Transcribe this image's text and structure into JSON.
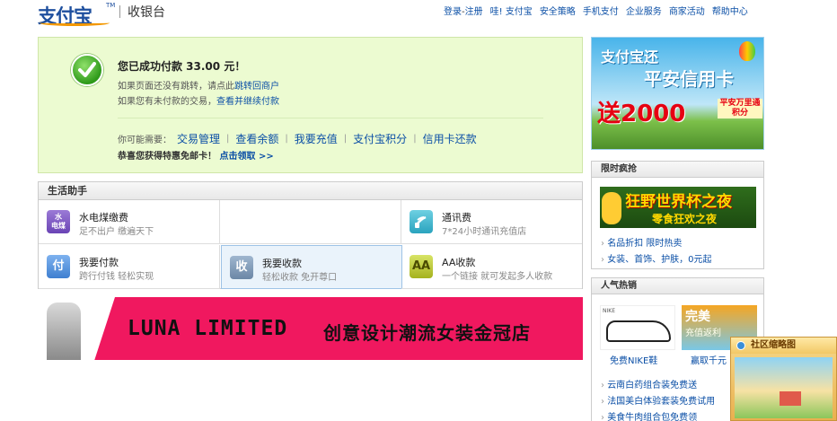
{
  "header": {
    "logo_text": "支付宝",
    "logo_tm": "TM",
    "title": "收银台",
    "nav": [
      "登录",
      "-",
      "注册",
      "哇!",
      "支付宝",
      "安全策略",
      "手机支付",
      "企业服务",
      "商家活动",
      "帮助中心"
    ]
  },
  "success": {
    "title": "您已成功付款 33.00 元！",
    "line1_prefix": "如果页面还没有跳转，请点此",
    "line1_link": "跳转回商户",
    "line2_prefix": "如果您有未付款的交易，",
    "line2_link": "查看并继续付款",
    "links_prefix": "你可能需要：",
    "links": [
      "交易管理",
      "查看余额",
      "我要充值",
      "支付宝积分",
      "信用卡还款"
    ],
    "promo_text": "恭喜您获得特惠免邮卡！",
    "promo_link": "点击领取 >>"
  },
  "helper": {
    "title": "生活助手",
    "cells": [
      {
        "icon": "water-electric-gas-icon",
        "icon_text": "水\n电煤",
        "title": "水电煤缴费",
        "sub": "足不出户 缴遍天下"
      },
      {
        "icon": "",
        "icon_text": "",
        "title": "",
        "sub": ""
      },
      {
        "icon": "phone-icon",
        "icon_text": "",
        "title": "通讯费",
        "sub": "7*24小时通讯充值店"
      },
      {
        "icon": "pay-icon",
        "icon_text": "付",
        "title": "我要付款",
        "sub": "跨行付钱 轻松实现"
      },
      {
        "icon": "receive-icon",
        "icon_text": "收",
        "title": "我要收款",
        "sub": "轻松收款 免开尊口"
      },
      {
        "icon": "aa-icon",
        "icon_text": "AA",
        "title": "AA收款",
        "sub": "一个链接 就可发起多人收款"
      }
    ]
  },
  "banner": {
    "brand": "LUNA LIMITED",
    "slogan": "创意设计潮流女装金冠店"
  },
  "ad_top": {
    "line1": "支付宝还",
    "line2": "平安信用卡",
    "line3": "送2000",
    "line4": "平安万里通积分"
  },
  "flash": {
    "title": "限时疯抢",
    "img_line1": "狂野世界杯之夜",
    "img_line2": "零食狂欢之夜",
    "items": [
      "名品折扣 限时热卖",
      "女装、首饰、护肤，0元起"
    ]
  },
  "hot": {
    "title": "人气热销",
    "img2_line1": "完美",
    "img2_line2": "充值返利",
    "caption1": "免费NIKE鞋",
    "caption2": "赢取千元",
    "items": [
      "云南白药组合装免费送",
      "法国美白体验套装免费试用",
      "美食牛肉组合包免费领"
    ]
  },
  "float": {
    "title": "社区缩略图"
  },
  "colors": {
    "link": "#0b4fa6",
    "success_bg": "#ecfbd1",
    "banner_bg": "#f0185f"
  }
}
